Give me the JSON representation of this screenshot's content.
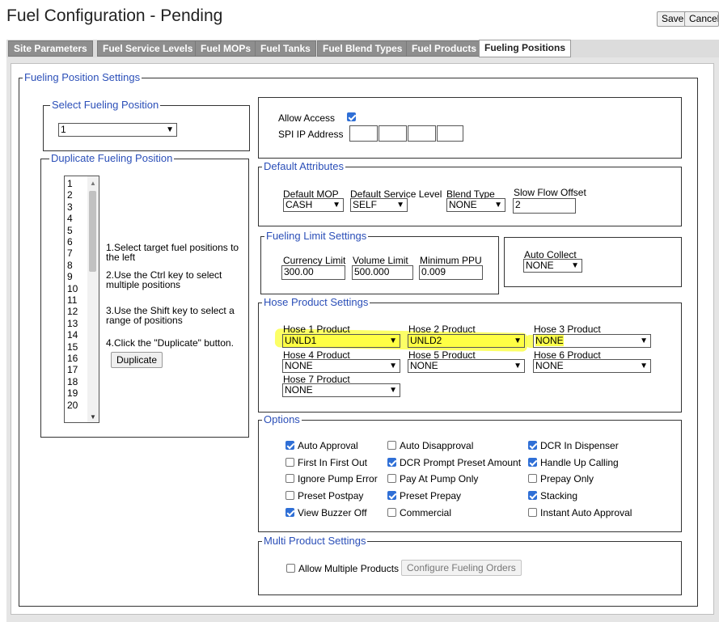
{
  "header": {
    "title": "Fuel Configuration - Pending",
    "save_label": "Save",
    "cancel_label": "Cancel"
  },
  "tabs": [
    "Site Parameters",
    "Fuel Service Levels",
    "Fuel MOPs",
    "Fuel Tanks",
    "Fuel Blend Types",
    "Fuel Products",
    "Fueling Positions"
  ],
  "active_tab": "Fueling Positions",
  "settings_legend": "Fueling Position Settings",
  "select_position": {
    "legend": "Select Fueling Position",
    "value": "1"
  },
  "duplicate": {
    "legend": "Duplicate Fueling Position",
    "positions": [
      "1",
      "2",
      "3",
      "4",
      "5",
      "6",
      "7",
      "8",
      "9",
      "10",
      "11",
      "12",
      "13",
      "14",
      "15",
      "16",
      "17",
      "18",
      "19",
      "20"
    ],
    "instructions": [
      "1.Select target fuel positions to the left",
      "2.Use the Ctrl key to select multiple positions",
      "3.Use the Shift key to select a range of positions",
      "4.Click the \"Duplicate\" button."
    ],
    "button_label": "Duplicate"
  },
  "access": {
    "allow_access_label": "Allow Access",
    "allow_access_checked": true,
    "spi_ip_label": "SPI IP Address",
    "spi_ip": [
      "",
      "",
      "",
      ""
    ]
  },
  "default_attributes": {
    "legend": "Default Attributes",
    "mop_label": "Default MOP",
    "mop_value": "CASH",
    "service_label": "Default Service Level",
    "service_value": "SELF",
    "blend_label": "Blend Type",
    "blend_value": "NONE",
    "slow_flow_label": "Slow Flow Offset",
    "slow_flow_value": "2"
  },
  "limits": {
    "legend": "Fueling Limit Settings",
    "currency_label": "Currency Limit",
    "currency_value": "300.00",
    "volume_label": "Volume Limit",
    "volume_value": "500.000",
    "ppu_label": "Minimum PPU",
    "ppu_value": "0.009"
  },
  "auto_collect": {
    "label": "Auto Collect",
    "value": "NONE"
  },
  "hoses": {
    "legend": "Hose Product Settings",
    "items": [
      {
        "label": "Hose 1 Product",
        "value": "UNLD1"
      },
      {
        "label": "Hose 2 Product",
        "value": "UNLD2"
      },
      {
        "label": "Hose 3 Product",
        "value": "NONE"
      },
      {
        "label": "Hose 4 Product",
        "value": "NONE"
      },
      {
        "label": "Hose 5 Product",
        "value": "NONE"
      },
      {
        "label": "Hose 6 Product",
        "value": "NONE"
      },
      {
        "label": "Hose 7 Product",
        "value": "NONE"
      }
    ]
  },
  "options": {
    "legend": "Options",
    "items": [
      {
        "label": "Auto Approval",
        "checked": true
      },
      {
        "label": "Auto Disapproval",
        "checked": false
      },
      {
        "label": "DCR In Dispenser",
        "checked": true
      },
      {
        "label": "First In First Out",
        "checked": false
      },
      {
        "label": "DCR Prompt Preset Amount",
        "checked": true
      },
      {
        "label": "Handle Up Calling",
        "checked": true
      },
      {
        "label": "Ignore Pump Error",
        "checked": false
      },
      {
        "label": "Pay At Pump Only",
        "checked": false
      },
      {
        "label": "Prepay Only",
        "checked": false
      },
      {
        "label": "Preset Postpay",
        "checked": false
      },
      {
        "label": "Preset Prepay",
        "checked": true
      },
      {
        "label": "Stacking",
        "checked": true
      },
      {
        "label": "View Buzzer Off",
        "checked": true
      },
      {
        "label": "Commercial",
        "checked": false
      },
      {
        "label": "Instant Auto Approval",
        "checked": false
      }
    ]
  },
  "multi_product": {
    "legend": "Multi Product Settings",
    "allow_label": "Allow Multiple Products",
    "allow_checked": false,
    "configure_label": "Configure Fueling Orders"
  },
  "colors": {
    "legend_blue": "#2b4fb8",
    "tab_gray": "#8e8e8e",
    "checkbox_blue": "#2f6fd6",
    "highlight_yellow": "#fbff4b"
  }
}
